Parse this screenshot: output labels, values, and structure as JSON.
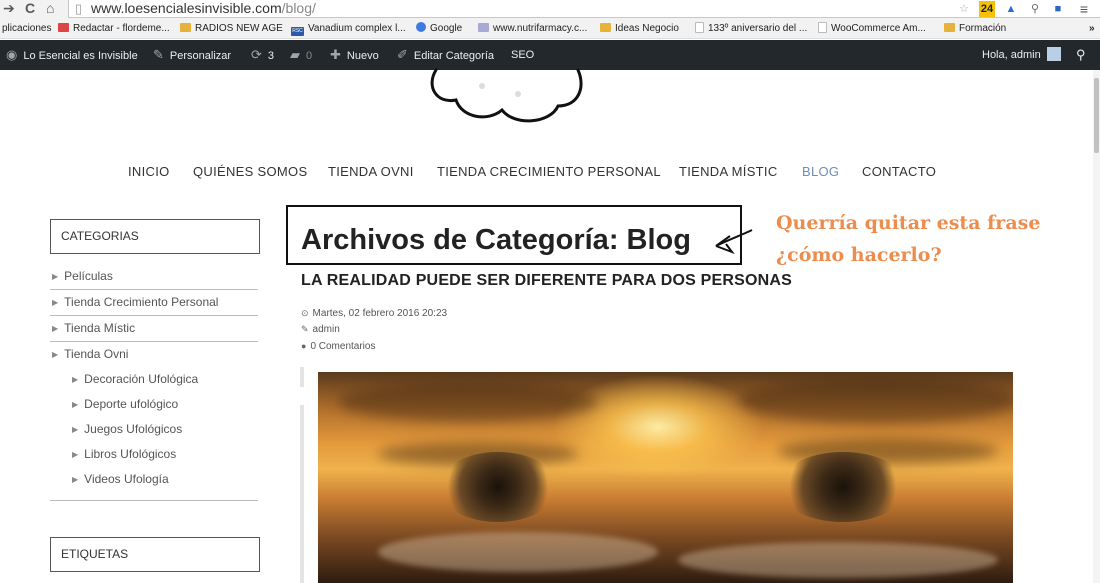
{
  "browser": {
    "url_domain": "www.loesencialesinvisible.com",
    "url_path": "/blog/",
    "bookmarks": [
      {
        "label": "plicaciones",
        "icon": "none"
      },
      {
        "label": "Redactar - flordeme...",
        "icon": "gmail"
      },
      {
        "label": "RADIOS NEW AGE",
        "icon": "folder"
      },
      {
        "label": "Vanadium complex l...",
        "icon": "rsc"
      },
      {
        "label": "Google",
        "icon": "google"
      },
      {
        "label": "www.nutrifarmacy.c...",
        "icon": "nutri"
      },
      {
        "label": "Ideas Negocio",
        "icon": "folder"
      },
      {
        "label": "133º aniversario del ...",
        "icon": "page"
      },
      {
        "label": "WooCommerce Am...",
        "icon": "page"
      },
      {
        "label": "Formación",
        "icon": "folder"
      }
    ],
    "ext_badge": "24"
  },
  "admin_bar": {
    "site_name": "Lo Esencial es Invisible",
    "customize": "Personalizar",
    "updates": "3",
    "comments": "0",
    "new": "Nuevo",
    "edit_category": "Editar Categoría",
    "seo": "SEO",
    "greeting": "Hola, admin"
  },
  "nav": {
    "items": [
      "INICIO",
      "QUIÉNES SOMOS",
      "TIENDA OVNI",
      "TIENDA CRECIMIENTO PERSONAL",
      "TIENDA MÍSTIC",
      "BLOG",
      "CONTACTO"
    ],
    "active": "BLOG"
  },
  "sidebar": {
    "categories_title": "CATEGORIAS",
    "categories": [
      {
        "label": "Películas",
        "level": 0
      },
      {
        "label": "Tienda Crecimiento Personal",
        "level": 0
      },
      {
        "label": "Tienda Místic",
        "level": 0
      },
      {
        "label": "Tienda Ovni",
        "level": 0
      },
      {
        "label": "Decoración Ufológica",
        "level": 1
      },
      {
        "label": "Deporte ufológico",
        "level": 1
      },
      {
        "label": "Juegos Ufológicos",
        "level": 1
      },
      {
        "label": "Libros Ufológicos",
        "level": 1
      },
      {
        "label": "Videos Ufología",
        "level": 1
      }
    ],
    "tags_title": "ETIQUETAS"
  },
  "main": {
    "archive_title": "Archivos de Categoría: Blog",
    "annotation_line1": "Querría quitar esta frase",
    "annotation_line2": "¿cómo hacerlo?",
    "post_title": "LA REALIDAD PUEDE SER DIFERENTE PARA DOS PERSONAS",
    "post_date": "Martes, 02 febrero 2016 20:23",
    "post_author": "admin",
    "post_comments": "0 Comentarios"
  },
  "colors": {
    "admin_bar_bg": "#23282d",
    "nav_active": "#6c8fb6",
    "annotation": "#ec8d4e"
  }
}
